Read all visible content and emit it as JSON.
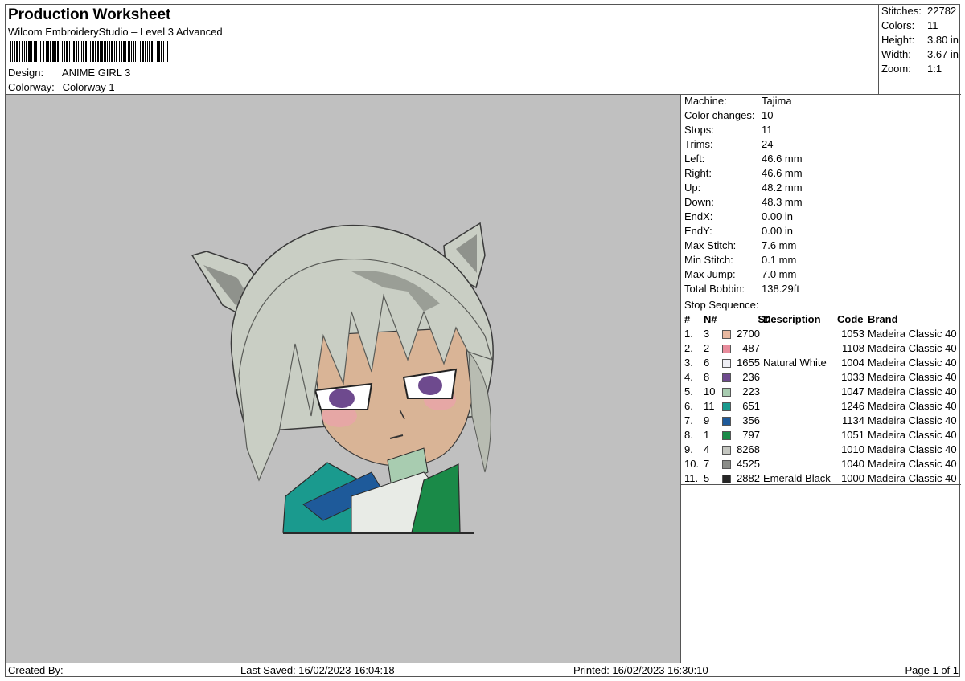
{
  "header": {
    "title": "Production Worksheet",
    "software": "Wilcom EmbroideryStudio – Level 3 Advanced",
    "design_label": "Design:",
    "design_value": "ANIME GIRL 3",
    "colorway_label": "Colorway:",
    "colorway_value": "Colorway 1"
  },
  "summary": [
    {
      "label": "Stitches:",
      "value": "22782"
    },
    {
      "label": "Colors:",
      "value": "11"
    },
    {
      "label": "Height:",
      "value": "3.80 in"
    },
    {
      "label": "Width:",
      "value": "3.67 in"
    },
    {
      "label": "Zoom:",
      "value": "1:1"
    }
  ],
  "machine_info": [
    {
      "label": "Machine:",
      "value": "Tajima"
    },
    {
      "label": "Color changes:",
      "value": "10"
    },
    {
      "label": "Stops:",
      "value": "11"
    },
    {
      "label": "Trims:",
      "value": "24"
    },
    {
      "label": "Left:",
      "value": "46.6 mm"
    },
    {
      "label": "Right:",
      "value": "46.6 mm"
    },
    {
      "label": "Up:",
      "value": "48.2 mm"
    },
    {
      "label": "Down:",
      "value": "48.3 mm"
    },
    {
      "label": "EndX:",
      "value": "0.00 in"
    },
    {
      "label": "EndY:",
      "value": "0.00 in"
    },
    {
      "label": "Max Stitch:",
      "value": "7.6 mm"
    },
    {
      "label": "Min Stitch:",
      "value": "0.1 mm"
    },
    {
      "label": "Max Jump:",
      "value": "7.0 mm"
    },
    {
      "label": "Total Bobbin:",
      "value": "138.29ft"
    }
  ],
  "stop_sequence": {
    "title": "Stop Sequence:",
    "headers": {
      "idx": "#",
      "num": "N#",
      "st": "St.",
      "desc": "Description",
      "code": "Code",
      "brand": "Brand"
    },
    "rows": [
      {
        "idx": "1.",
        "num": "3",
        "color": "#e8b8a0",
        "st": "2700",
        "desc": "",
        "code": "1053",
        "brand": "Madeira Classic 40"
      },
      {
        "idx": "2.",
        "num": "2",
        "color": "#e88c9c",
        "st": "487",
        "desc": "",
        "code": "1108",
        "brand": "Madeira Classic 40"
      },
      {
        "idx": "3.",
        "num": "6",
        "color": "#eeeef4",
        "st": "1655",
        "desc": "Natural White",
        "code": "1004",
        "brand": "Madeira Classic 40"
      },
      {
        "idx": "4.",
        "num": "8",
        "color": "#6e4a8e",
        "st": "236",
        "desc": "",
        "code": "1033",
        "brand": "Madeira Classic 40"
      },
      {
        "idx": "5.",
        "num": "10",
        "color": "#a8ccb0",
        "st": "223",
        "desc": "",
        "code": "1047",
        "brand": "Madeira Classic 40"
      },
      {
        "idx": "6.",
        "num": "11",
        "color": "#1a9a8e",
        "st": "651",
        "desc": "",
        "code": "1246",
        "brand": "Madeira Classic 40"
      },
      {
        "idx": "7.",
        "num": "9",
        "color": "#1e5a9a",
        "st": "356",
        "desc": "",
        "code": "1134",
        "brand": "Madeira Classic 40"
      },
      {
        "idx": "8.",
        "num": "1",
        "color": "#1a8a48",
        "st": "797",
        "desc": "",
        "code": "1051",
        "brand": "Madeira Classic 40"
      },
      {
        "idx": "9.",
        "num": "4",
        "color": "#c4c6c0",
        "st": "8268",
        "desc": "",
        "code": "1010",
        "brand": "Madeira Classic 40"
      },
      {
        "idx": "10.",
        "num": "7",
        "color": "#8a8c88",
        "st": "4525",
        "desc": "",
        "code": "1040",
        "brand": "Madeira Classic 40"
      },
      {
        "idx": "11.",
        "num": "5",
        "color": "#262626",
        "st": "2882",
        "desc": "Emerald Black",
        "code": "1000",
        "brand": "Madeira Classic 40"
      }
    ]
  },
  "footer": {
    "created_by": "Created By:",
    "last_saved": "Last Saved: 16/02/2023 16:04:18",
    "printed": "Printed: 16/02/2023 16:30:10",
    "page": "Page 1 of 1"
  },
  "colors": {
    "preview_bg": "#c0c0c0",
    "hair": "#c9cec4",
    "hair_shadow": "#9a9e96",
    "skin": "#d9b496",
    "blush": "#e8a4a8",
    "eye": "#6e4a8e",
    "teal": "#1a9a8e",
    "blue": "#1e5a9a",
    "green": "#1a8a48",
    "mint": "#a8ccb0"
  }
}
